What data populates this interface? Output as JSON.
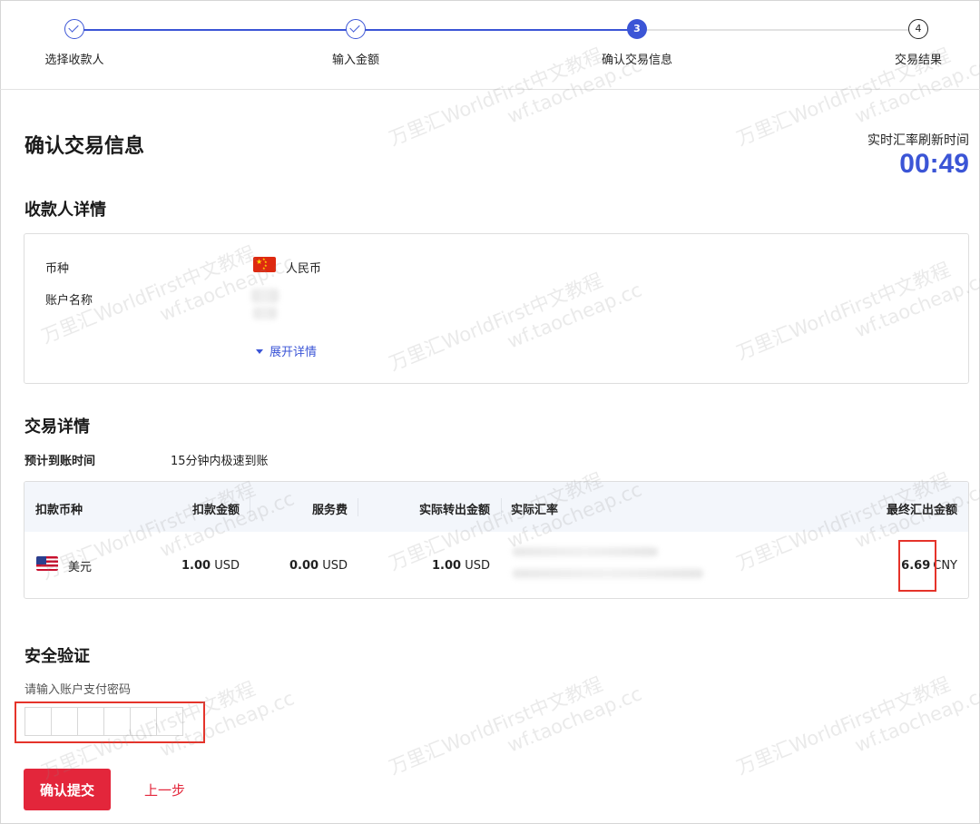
{
  "steps": [
    {
      "label": "选择收款人",
      "state": "done"
    },
    {
      "label": "输入金额",
      "state": "done"
    },
    {
      "number": "3",
      "label": "确认交易信息",
      "state": "current"
    },
    {
      "number": "4",
      "label": "交易结果",
      "state": "todo"
    }
  ],
  "header": {
    "title": "确认交易信息",
    "refresh_label": "实时汇率刷新时间",
    "refresh_time": "00:49"
  },
  "payee": {
    "section_title": "收款人详情",
    "currency_label": "币种",
    "currency_value": "人民币",
    "account_label": "账户名称",
    "expand_label": "展开详情"
  },
  "transaction": {
    "section_title": "交易详情",
    "arrival_label": "预计到账时间",
    "arrival_value": "15分钟内极速到账",
    "columns": [
      "扣款币种",
      "扣款金额",
      "服务费",
      "实际转出金额",
      "实际汇率",
      "最终汇出金额"
    ],
    "row": {
      "currency": "美元",
      "debit_amount": "1.00",
      "debit_unit": "USD",
      "fee_amount": "0.00",
      "fee_unit": "USD",
      "actual_amount": "1.00",
      "actual_unit": "USD",
      "final_amount": "6.69",
      "final_unit": "CNY"
    }
  },
  "security": {
    "section_title": "安全验证",
    "hint": "请输入账户支付密码"
  },
  "actions": {
    "submit_label": "确认提交",
    "back_label": "上一步"
  },
  "watermark": {
    "line1": "万里汇WorldFirst中文教程",
    "line2": "wf.taocheap.cc"
  },
  "colors": {
    "primary": "#3b55d6",
    "danger": "#e3263b",
    "table_header_bg": "#f3f6fb"
  }
}
